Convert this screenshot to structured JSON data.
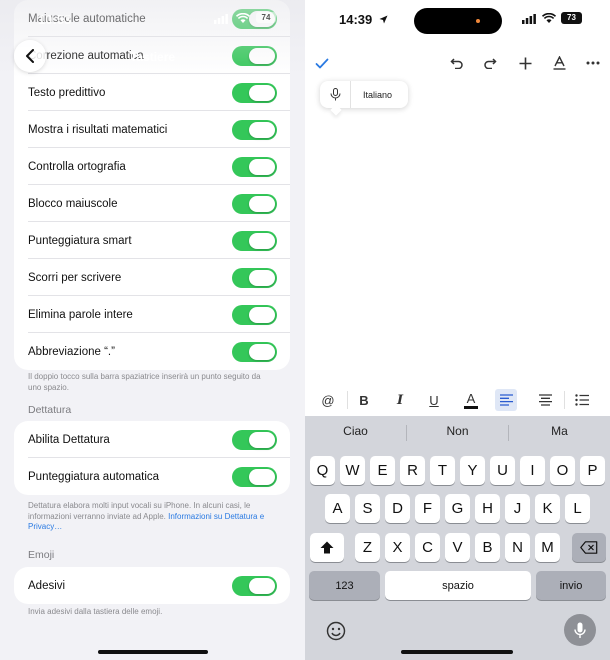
{
  "left": {
    "status_time": "10:53",
    "battery": "74",
    "nav_title": "Tastiere",
    "top_group": [
      {
        "label": "Maiuscole automatiche"
      },
      {
        "label": "Correzione automatica"
      },
      {
        "label": "Testo predittivo"
      },
      {
        "label": "Mostra i risultati matematici"
      },
      {
        "label": "Controlla ortografia"
      },
      {
        "label": "Blocco maiuscole"
      },
      {
        "label": "Punteggiatura smart"
      },
      {
        "label": "Scorri per scrivere"
      },
      {
        "label": "Elimina parole intere"
      },
      {
        "label": "Abbreviazione “.”"
      }
    ],
    "top_footer": "Il doppio tocco sulla barra spaziatrice inserirà un punto seguito da uno spazio.",
    "dictation_header": "Dettatura",
    "dictation_group": [
      {
        "label": "Abilita Dettatura"
      },
      {
        "label": "Punteggiatura automatica"
      }
    ],
    "dictation_footer": "Dettatura elabora molti input vocali su iPhone. In alcuni casi, le informazioni verranno inviate ad Apple. ",
    "dictation_link": "Informazioni su Dettatura e Privacy…",
    "emoji_header": "Emoji",
    "emoji_group": [
      {
        "label": "Adesivi"
      }
    ],
    "emoji_footer": "Invia adesivi dalla tastiera delle emoji.",
    "toggles_on": true
  },
  "right": {
    "status_time": "14:39",
    "battery": "73",
    "dictation_language": "Italiano",
    "suggestions": [
      "Ciao",
      "Non",
      "Ma"
    ],
    "rows": [
      [
        "Q",
        "W",
        "E",
        "R",
        "T",
        "Y",
        "U",
        "I",
        "O",
        "P"
      ],
      [
        "A",
        "S",
        "D",
        "F",
        "G",
        "H",
        "J",
        "K",
        "L"
      ],
      [
        "Z",
        "X",
        "C",
        "V",
        "B",
        "N",
        "M"
      ]
    ],
    "key_123": "123",
    "key_space": "spazio",
    "key_return": "invio",
    "format_buttons": [
      "@",
      "B",
      "I",
      "U",
      "A"
    ]
  },
  "colors": {
    "toggle_on": "#34c759",
    "accent": "#2a7ae2",
    "settings_bg": "#f2f2f6",
    "keyboard_bg": "#d3d5db"
  }
}
